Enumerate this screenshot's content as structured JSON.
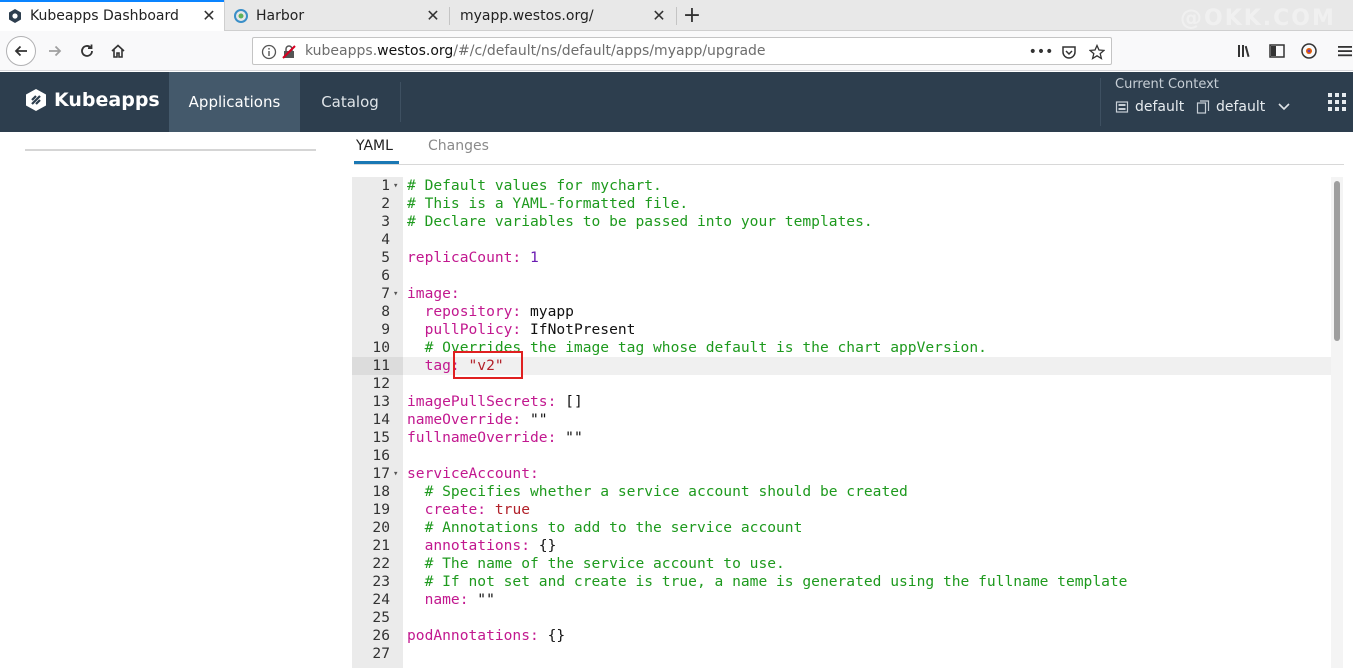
{
  "browser": {
    "tabs": [
      {
        "title": "Kubeapps Dashboard",
        "active": true,
        "icon": "kubeapps-favicon"
      },
      {
        "title": "Harbor",
        "active": false,
        "icon": "harbor-favicon"
      },
      {
        "title": "myapp.westos.org/",
        "active": false,
        "icon": ""
      }
    ],
    "url": {
      "prefix": "kubeapps.",
      "host": "westos.org",
      "path": "/#/c/default/ns/default/apps/myapp/upgrade"
    },
    "watermark": "@OKK.COM"
  },
  "app": {
    "brand": "Kubeapps",
    "menu": {
      "applications": "Applications",
      "catalog": "Catalog"
    },
    "context": {
      "label": "Current Context",
      "cluster": "default",
      "namespace": "default"
    }
  },
  "editor_tabs": {
    "yaml": "YAML",
    "changes": "Changes"
  },
  "colors": {
    "header": "#2d3e4e",
    "active_menu": "#44596b",
    "tab_accent": "#1a78b4",
    "highlight_box": "#e02020"
  },
  "code": [
    {
      "n": "1",
      "fold": true,
      "parts": [
        {
          "t": "# Default values for mychart.",
          "c": "comment"
        }
      ]
    },
    {
      "n": "2",
      "parts": [
        {
          "t": "# This is a YAML-formatted file.",
          "c": "comment"
        }
      ]
    },
    {
      "n": "3",
      "parts": [
        {
          "t": "# Declare variables to be passed into your templates.",
          "c": "comment"
        }
      ]
    },
    {
      "n": "4",
      "parts": []
    },
    {
      "n": "5",
      "parts": [
        {
          "t": "replicaCount: ",
          "c": "key"
        },
        {
          "t": "1",
          "c": "num"
        }
      ]
    },
    {
      "n": "6",
      "parts": []
    },
    {
      "n": "7",
      "fold": true,
      "parts": [
        {
          "t": "image:",
          "c": "key"
        }
      ]
    },
    {
      "n": "8",
      "parts": [
        {
          "t": "  repository: ",
          "c": "key"
        },
        {
          "t": "myapp",
          "c": "plain"
        }
      ]
    },
    {
      "n": "9",
      "parts": [
        {
          "t": "  pullPolicy: ",
          "c": "key"
        },
        {
          "t": "IfNotPresent",
          "c": "plain"
        }
      ]
    },
    {
      "n": "10",
      "parts": [
        {
          "t": "  # Overrides the image tag whose default is the chart appVersion.",
          "c": "comment"
        }
      ]
    },
    {
      "n": "11",
      "parts": [
        {
          "t": "  tag: ",
          "c": "key"
        },
        {
          "t": "\"v2\"",
          "c": "str"
        }
      ]
    },
    {
      "n": "12",
      "parts": []
    },
    {
      "n": "13",
      "parts": [
        {
          "t": "imagePullSecrets: ",
          "c": "key"
        },
        {
          "t": "[]",
          "c": "plain"
        }
      ]
    },
    {
      "n": "14",
      "parts": [
        {
          "t": "nameOverride: ",
          "c": "key"
        },
        {
          "t": "\"\"",
          "c": "plain"
        }
      ]
    },
    {
      "n": "15",
      "parts": [
        {
          "t": "fullnameOverride: ",
          "c": "key"
        },
        {
          "t": "\"\"",
          "c": "plain"
        }
      ]
    },
    {
      "n": "16",
      "parts": []
    },
    {
      "n": "17",
      "fold": true,
      "parts": [
        {
          "t": "serviceAccount:",
          "c": "key"
        }
      ]
    },
    {
      "n": "18",
      "parts": [
        {
          "t": "  # Specifies whether a service account should be created",
          "c": "comment"
        }
      ]
    },
    {
      "n": "19",
      "parts": [
        {
          "t": "  create: ",
          "c": "key"
        },
        {
          "t": "true",
          "c": "bool"
        }
      ]
    },
    {
      "n": "20",
      "parts": [
        {
          "t": "  # Annotations to add to the service account",
          "c": "comment"
        }
      ]
    },
    {
      "n": "21",
      "parts": [
        {
          "t": "  annotations: ",
          "c": "key"
        },
        {
          "t": "{}",
          "c": "plain"
        }
      ]
    },
    {
      "n": "22",
      "parts": [
        {
          "t": "  # The name of the service account to use.",
          "c": "comment"
        }
      ]
    },
    {
      "n": "23",
      "parts": [
        {
          "t": "  # If not set and create is true, a name is generated using the fullname template",
          "c": "comment"
        }
      ]
    },
    {
      "n": "24",
      "parts": [
        {
          "t": "  name: ",
          "c": "key"
        },
        {
          "t": "\"\"",
          "c": "plain"
        }
      ]
    },
    {
      "n": "25",
      "parts": []
    },
    {
      "n": "26",
      "parts": [
        {
          "t": "podAnnotations: ",
          "c": "key"
        },
        {
          "t": "{}",
          "c": "plain"
        }
      ]
    },
    {
      "n": "27",
      "parts": []
    }
  ]
}
